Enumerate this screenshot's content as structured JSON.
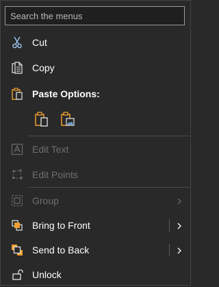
{
  "search": {
    "placeholder": "Search the menus"
  },
  "items": {
    "cut": {
      "label": "Cut",
      "icon": "scissors-icon"
    },
    "copy": {
      "label": "Copy",
      "icon": "copy-icon"
    },
    "paste_options": {
      "label": "Paste Options:",
      "icon": "clipboard-icon"
    },
    "edit_text": {
      "label": "Edit Text",
      "icon": "text-frame-icon",
      "disabled": true
    },
    "edit_points": {
      "label": "Edit Points",
      "icon": "edit-points-icon",
      "disabled": true
    },
    "group": {
      "label": "Group",
      "icon": "group-icon",
      "disabled": true,
      "has_submenu": true
    },
    "bring_to_front": {
      "label": "Bring to Front",
      "icon": "bring-front-icon",
      "has_submenu": true
    },
    "send_to_back": {
      "label": "Send to Back",
      "icon": "send-back-icon",
      "has_submenu": true
    },
    "unlock": {
      "label": "Unlock",
      "icon": "unlock-icon"
    }
  },
  "paste_buttons": [
    "paste-keep-source-icon",
    "paste-picture-icon"
  ],
  "colors": {
    "background": "#292929",
    "text": "#ffffff",
    "disabled_text": "#6f6f6f",
    "accent_orange": "#f0a030",
    "icon_blue": "#6fa8dc"
  }
}
